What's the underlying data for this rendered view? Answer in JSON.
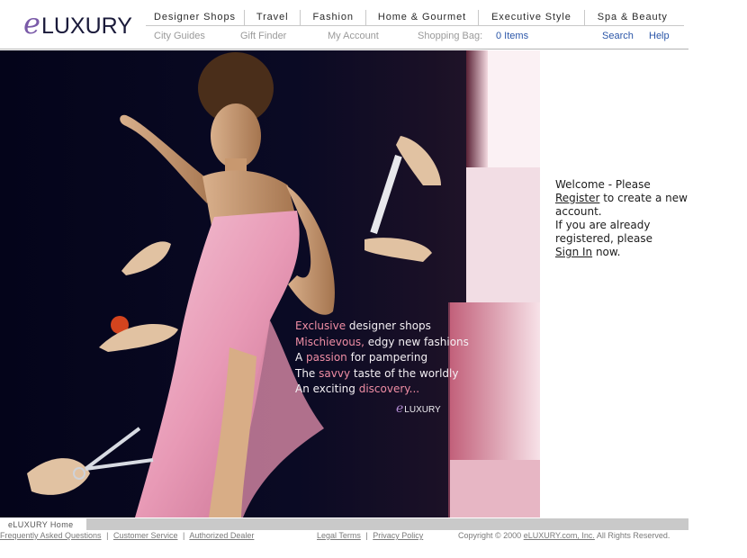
{
  "brand": {
    "logo_e": "e",
    "logo_word": "LUXURY"
  },
  "top_nav": [
    {
      "label": "Designer Shops"
    },
    {
      "label": "Travel"
    },
    {
      "label": "Fashion"
    },
    {
      "label": "Home & Gourmet"
    },
    {
      "label": "Executive Style"
    },
    {
      "label": "Spa & Beauty"
    }
  ],
  "sub_nav": {
    "city_guides": "City Guides",
    "gift_finder": "Gift Finder",
    "my_account": "My Account",
    "shopping_bag_label": "Shopping Bag:",
    "shopping_bag_items": "0 Items",
    "search": "Search",
    "help": "Help"
  },
  "hero": {
    "lines": [
      {
        "highlight": "Exclusive",
        "rest": " designer shops",
        "order": "first"
      },
      {
        "highlight": "Mischievous,",
        "rest": " edgy new fashions",
        "order": "first"
      },
      {
        "before": "A ",
        "highlight": "passion",
        "rest": " for pampering",
        "order": "middle"
      },
      {
        "before": "The ",
        "highlight": "savvy",
        "rest": " taste of the worldly",
        "order": "middle"
      },
      {
        "before": "An exciting ",
        "highlight": "discovery...",
        "rest": "",
        "order": "middle"
      }
    ],
    "logo_e": "e",
    "logo_word": "LUXURY"
  },
  "welcome": {
    "intro": "Welcome - Please",
    "register_link": "Register",
    "register_rest": " to create a new account.",
    "already": "If you are already registered, please",
    "signin_link": "Sign In",
    "signin_rest": " now."
  },
  "footer": {
    "home_tab": "eLUXURY Home",
    "faq": "Frequently Asked Questions",
    "customer_service": "Customer Service",
    "authorized_dealer": "Authorized Dealer",
    "legal_terms": "Legal Terms",
    "privacy_policy": "Privacy Policy",
    "copyright_prefix": "Copyright © 2000 ",
    "company_link": "eLUXURY.com, Inc.",
    "copyright_suffix": " All Rights Reserved.",
    "separator": "|"
  }
}
